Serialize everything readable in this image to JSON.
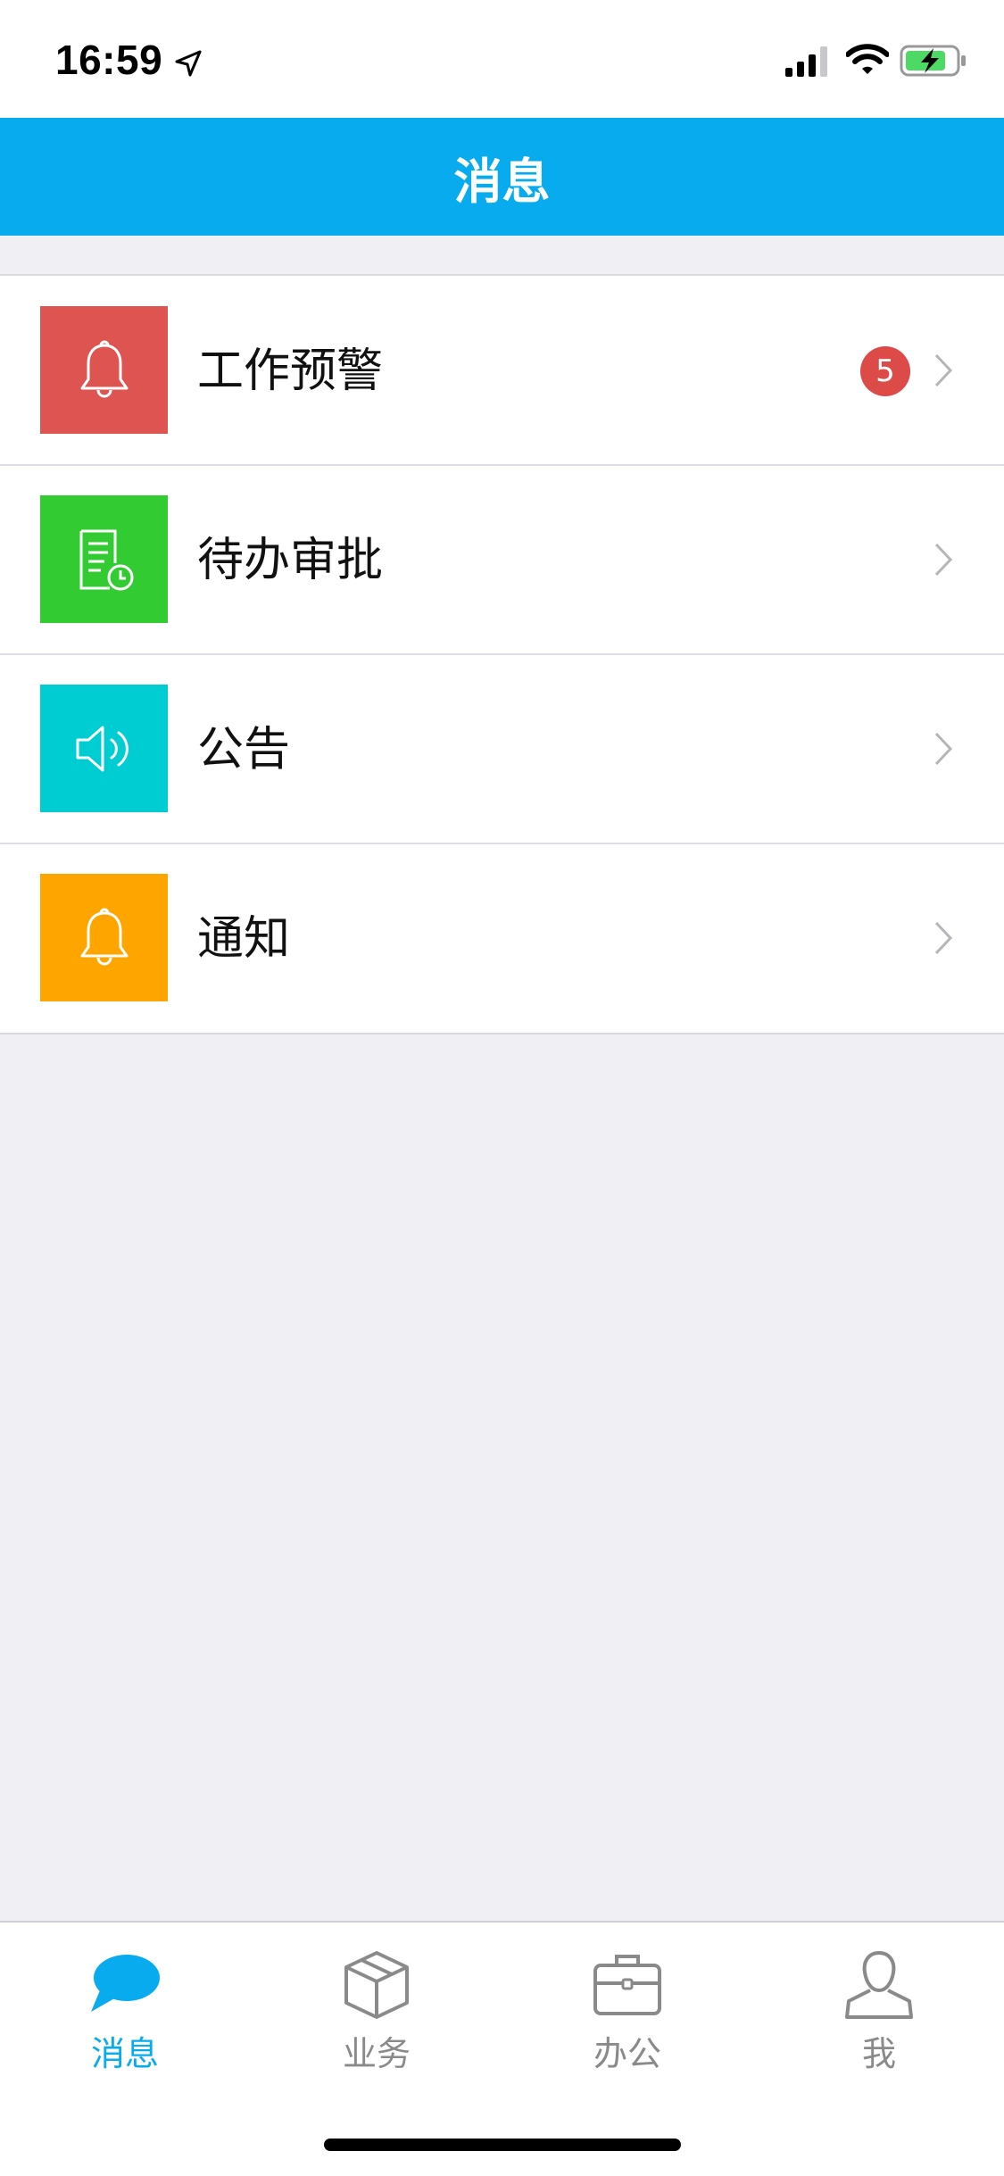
{
  "status_bar": {
    "time": "16:59"
  },
  "header": {
    "title": "消息"
  },
  "list": [
    {
      "label": "工作预警",
      "icon": "bell-icon",
      "color": "#dd5450",
      "badge": "5"
    },
    {
      "label": "待办审批",
      "icon": "document-clock-icon",
      "color": "#32cc32",
      "badge": null
    },
    {
      "label": "公告",
      "icon": "speaker-icon",
      "color": "#00cdd2",
      "badge": null
    },
    {
      "label": "通知",
      "icon": "bell-icon",
      "color": "#ffa500",
      "badge": null
    }
  ],
  "tabs": [
    {
      "label": "消息",
      "icon": "chat-bubble-icon",
      "active": true
    },
    {
      "label": "业务",
      "icon": "box-icon",
      "active": false
    },
    {
      "label": "办公",
      "icon": "briefcase-icon",
      "active": false
    },
    {
      "label": "我",
      "icon": "person-icon",
      "active": false
    }
  ],
  "colors": {
    "accent": "#08abed",
    "inactive": "#8a8a8a"
  }
}
